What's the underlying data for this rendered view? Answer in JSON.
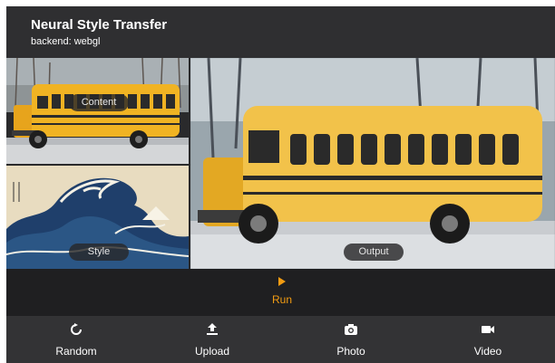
{
  "header": {
    "title": "Neural Style Transfer",
    "subtitle": "backend: webgl"
  },
  "panes": {
    "content_label": "Content",
    "style_label": "Style",
    "output_label": "Output"
  },
  "run": {
    "label": "Run",
    "icon": "play-icon",
    "color": "#f39c12"
  },
  "toolbar": {
    "items": [
      {
        "label": "Random",
        "icon": "refresh-icon"
      },
      {
        "label": "Upload",
        "icon": "upload-icon"
      },
      {
        "label": "Photo",
        "icon": "camera-icon"
      },
      {
        "label": "Video",
        "icon": "video-icon"
      }
    ]
  },
  "colors": {
    "background": "#2a2a2c",
    "bus_yellow": "#f0b323"
  }
}
